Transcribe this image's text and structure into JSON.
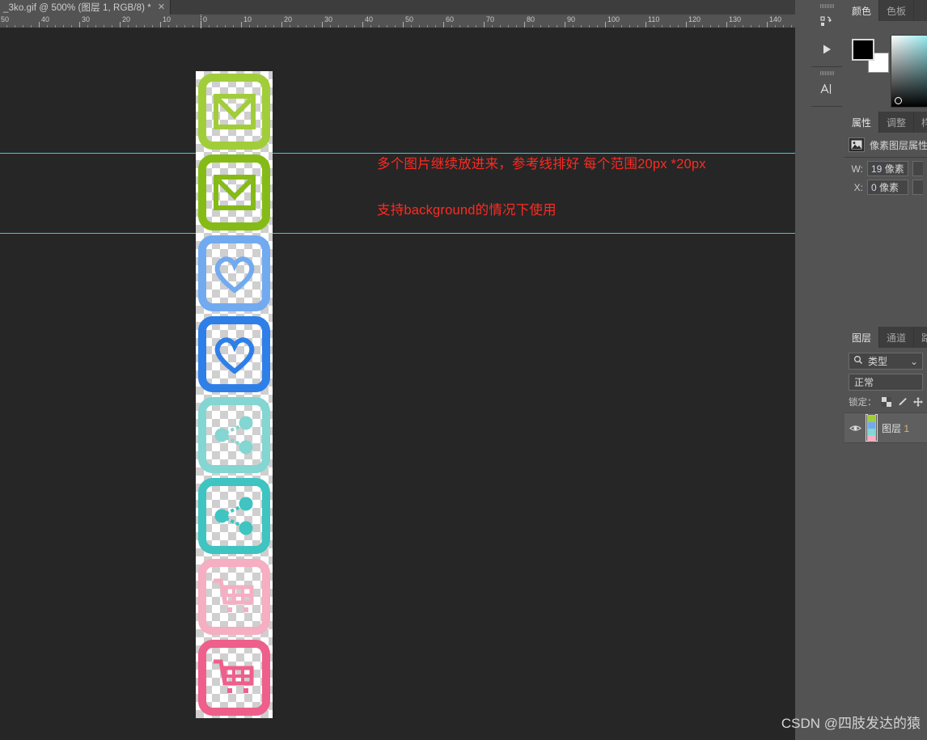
{
  "document": {
    "tab_title": "_3ko.gif @ 500% (图层 1, RGB/8) *",
    "close_glyph": "✕"
  },
  "ruler": {
    "labels_left": [
      "50",
      "40",
      "30",
      "20",
      "10",
      "0"
    ],
    "labels_right": [
      "10",
      "20",
      "30",
      "40",
      "50",
      "60",
      "70",
      "80",
      "90",
      "100",
      "110",
      "120",
      "130",
      "140"
    ],
    "unit": "像素"
  },
  "canvas": {
    "annotations": [
      "多个图片继续放进来，参考线排好 每个范围20px *20px",
      "支持background的情况下使用"
    ],
    "guide_color": "#2ad5e0",
    "annotation_color": "#ff2a21",
    "background_color": "#262626",
    "sprites": [
      {
        "name": "mail-icon-light-green",
        "glyph": "mail",
        "color": "#a2cd3a"
      },
      {
        "name": "mail-icon-green",
        "glyph": "mail",
        "color": "#85bb16"
      },
      {
        "name": "heart-icon-light-blue",
        "glyph": "heart",
        "color": "#72aaf0"
      },
      {
        "name": "heart-icon-blue",
        "glyph": "heart",
        "color": "#2f7fe8"
      },
      {
        "name": "share-icon-light-teal",
        "glyph": "share",
        "color": "#83d6d2"
      },
      {
        "name": "share-icon-teal",
        "glyph": "share",
        "color": "#3fc4c1"
      },
      {
        "name": "cart-icon-light-pink",
        "glyph": "cart",
        "color": "#f5aec2"
      },
      {
        "name": "cart-icon-pink",
        "glyph": "cart",
        "color": "#ef5f8c"
      }
    ]
  },
  "icon_rail": {
    "items": [
      {
        "name": "libraries-icon",
        "glyph": "libraries"
      },
      {
        "name": "actions-play-icon",
        "glyph": "play"
      },
      {
        "name": "character-panel-icon",
        "glyph": "A|"
      }
    ]
  },
  "color_panel": {
    "tabs": [
      {
        "label": "颜色",
        "active": true
      },
      {
        "label": "色板",
        "active": false
      }
    ],
    "foreground_color": "#000000",
    "background_color": "#ffffff",
    "field_hue_color": "#35d6e0"
  },
  "properties_panel": {
    "tabs": [
      {
        "label": "属性",
        "active": true
      },
      {
        "label": "调整",
        "active": false
      },
      {
        "label": "样",
        "active": false
      }
    ],
    "header_title": "像素图层属性",
    "rows": [
      {
        "label": "W:",
        "value": "19",
        "unit": "像素"
      },
      {
        "label": "X:",
        "value": "0",
        "unit": "像素"
      }
    ]
  },
  "layers_panel": {
    "tabs": [
      {
        "label": "图层",
        "active": true
      },
      {
        "label": "通道",
        "active": false
      },
      {
        "label": "路",
        "active": false
      }
    ],
    "filter": {
      "value": "类型",
      "icon": "search-icon",
      "chevron": "⌄"
    },
    "blend_mode": "正常",
    "lock_label": "锁定：",
    "lock_icons": [
      "transparency-lock-icon",
      "brush-lock-icon",
      "move-lock-icon"
    ],
    "layers": [
      {
        "name": "图层",
        "index": "1",
        "visible": true
      }
    ]
  },
  "watermark": "CSDN @四肢发达的猿"
}
